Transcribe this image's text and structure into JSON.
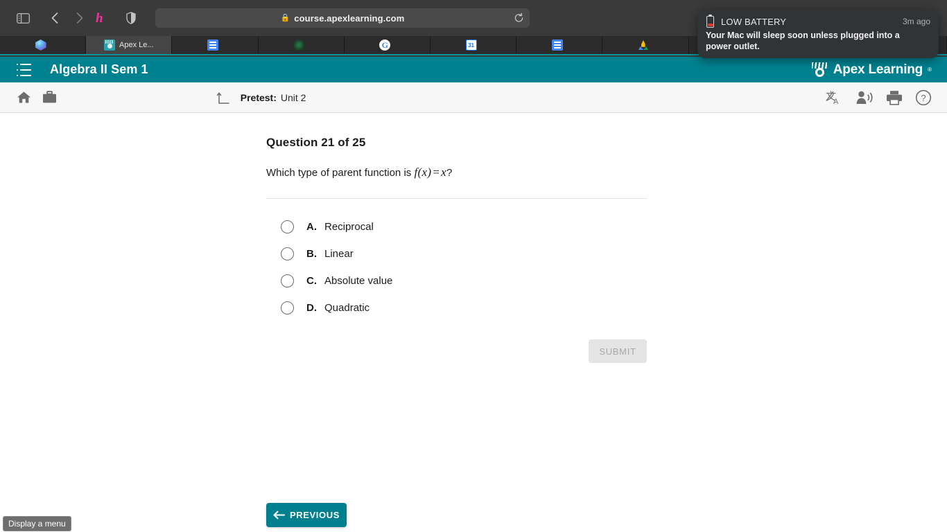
{
  "browser": {
    "url": "course.apexlearning.com",
    "lock_icon": "lock-icon",
    "sidebar_icon": "sidebar-toggle-icon",
    "back_icon": "chevron-left-icon",
    "forward_icon": "chevron-right-icon",
    "honey_icon": "honey-extension-icon",
    "shield_icon": "shield-privacy-icon",
    "reload_icon": "reload-icon",
    "tabs": [
      {
        "title": "",
        "favicon": "gem-icon",
        "active": false
      },
      {
        "title": "Apex Le...",
        "favicon": "apex-learning-icon",
        "active": true
      },
      {
        "title": "",
        "favicon": "google-docs-icon",
        "active": false
      },
      {
        "title": "",
        "favicon": "dark-green-circle-icon",
        "active": false
      },
      {
        "title": "",
        "favicon": "google-icon",
        "active": false
      },
      {
        "title": "",
        "favicon": "google-calendar-icon",
        "active": false
      },
      {
        "title": "",
        "favicon": "google-docs-icon",
        "active": false
      },
      {
        "title": "",
        "favicon": "google-drive-icon",
        "active": false
      },
      {
        "title": "",
        "favicon": "google-docs-icon",
        "active": false
      },
      {
        "title": "",
        "favicon": "newsela-n-icon",
        "active": false
      },
      {
        "title": "",
        "favicon": "lifesaver-icon",
        "active": false
      }
    ]
  },
  "notification": {
    "icon": "low-battery-icon",
    "title": "LOW BATTERY",
    "time": "3m ago",
    "body": "Your Mac will sleep soon unless plugged into a power outlet."
  },
  "apex_header": {
    "menu_icon": "list-menu-icon",
    "course_title": "Algebra II Sem 1",
    "logo_text": "Apex Learning",
    "logo_tm": "®",
    "logo_icon": "apex-learning-logo-icon",
    "background_color": "#00818f"
  },
  "sub_toolbar": {
    "home_icon": "home-icon",
    "briefcase_icon": "briefcase-icon",
    "up_arrow_icon": "up-arrow-icon",
    "breadcrumb_label": "Pretest:",
    "breadcrumb_value": "Unit 2",
    "translate_icon": "translate-icon",
    "read_aloud_icon": "read-aloud-icon",
    "print_icon": "print-icon",
    "help_icon": "help-icon"
  },
  "question": {
    "number_label": "Question 21 of 25",
    "prompt_prefix": "Which type of parent function is ",
    "math_f": "f",
    "math_paren_open": "(",
    "math_x1": "x",
    "math_paren_close": ")",
    "math_equals": "=",
    "math_x2": "x",
    "prompt_suffix": "?",
    "options": [
      {
        "letter": "A.",
        "text": "Reciprocal",
        "selected": false
      },
      {
        "letter": "B.",
        "text": "Linear",
        "selected": false
      },
      {
        "letter": "C.",
        "text": "Absolute value",
        "selected": false
      },
      {
        "letter": "D.",
        "text": "Quadratic",
        "selected": false
      }
    ],
    "submit_label": "SUBMIT",
    "submit_enabled": false
  },
  "footer": {
    "previous_label": "PREVIOUS",
    "previous_icon": "arrow-left-icon",
    "previous_color": "#00808f"
  },
  "tooltip": {
    "text": "Display a menu"
  }
}
